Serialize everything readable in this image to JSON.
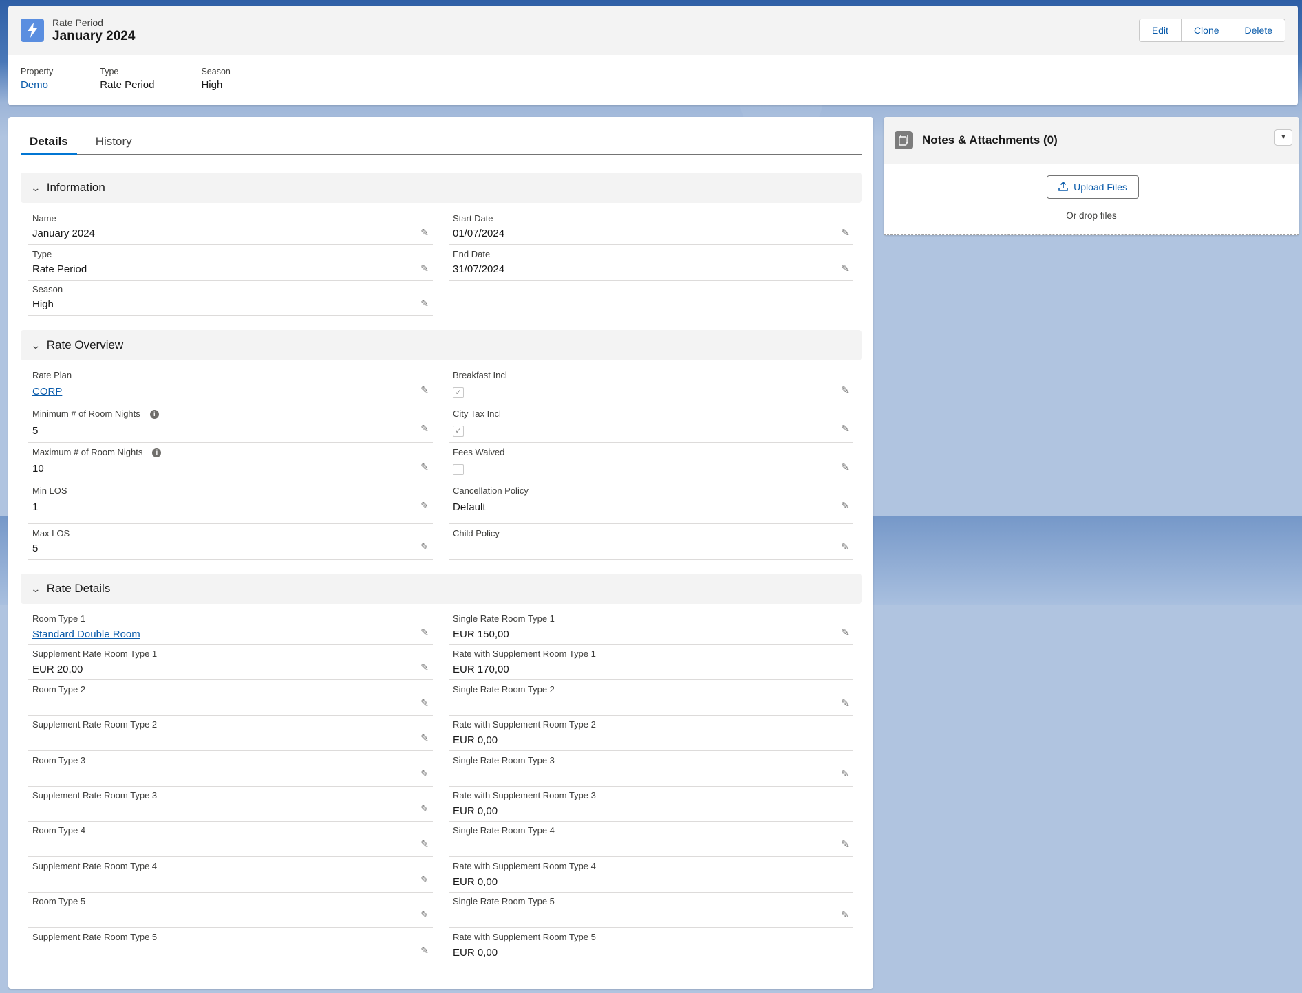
{
  "header": {
    "object_label": "Rate Period",
    "record_name": "January 2024",
    "actions": {
      "edit": "Edit",
      "clone": "Clone",
      "delete": "Delete"
    },
    "highlights": [
      {
        "label": "Property",
        "value": "Demo"
      },
      {
        "label": "Type",
        "value": "Rate Period"
      },
      {
        "label": "Season",
        "value": "High"
      }
    ]
  },
  "tabs": {
    "details": "Details",
    "history": "History"
  },
  "sections": {
    "information": {
      "title": "Information",
      "name_label": "Name",
      "name_value": "January 2024",
      "type_label": "Type",
      "type_value": "Rate Period",
      "season_label": "Season",
      "season_value": "High",
      "start_label": "Start Date",
      "start_value": "01/07/2024",
      "end_label": "End Date",
      "end_value": "31/07/2024"
    },
    "rate_overview": {
      "title": "Rate Overview",
      "rate_plan_label": "Rate Plan",
      "rate_plan_value": "CORP",
      "min_nights_label": "Minimum # of Room Nights",
      "min_nights_value": "5",
      "max_nights_label": "Maximum # of Room Nights",
      "max_nights_value": "10",
      "min_los_label": "Min LOS",
      "min_los_value": "1",
      "max_los_label": "Max LOS",
      "max_los_value": "5",
      "breakfast_label": "Breakfast Incl",
      "breakfast_checked": true,
      "city_tax_label": "City Tax Incl",
      "city_tax_checked": true,
      "fees_label": "Fees Waived",
      "fees_checked": false,
      "cancel_label": "Cancellation Policy",
      "cancel_value": "Default",
      "child_label": "Child Policy",
      "child_value": ""
    },
    "rate_details": {
      "title": "Rate Details",
      "left": [
        {
          "label": "Room Type 1",
          "value": "Standard Double Room",
          "link": true
        },
        {
          "label": "Supplement Rate Room Type 1",
          "value": "EUR 20,00"
        },
        {
          "label": "Room Type 2",
          "value": ""
        },
        {
          "label": "Supplement Rate Room Type 2",
          "value": ""
        },
        {
          "label": "Room Type 3",
          "value": ""
        },
        {
          "label": "Supplement Rate Room Type 3",
          "value": ""
        },
        {
          "label": "Room Type 4",
          "value": ""
        },
        {
          "label": "Supplement Rate Room Type 4",
          "value": ""
        },
        {
          "label": "Room Type 5",
          "value": ""
        },
        {
          "label": "Supplement Rate Room Type 5",
          "value": ""
        }
      ],
      "right": [
        {
          "label": "Single Rate Room Type 1",
          "value": "EUR 150,00",
          "editable": true
        },
        {
          "label": "Rate with Supplement Room Type 1",
          "value": "EUR 170,00",
          "editable": false
        },
        {
          "label": "Single Rate Room Type 2",
          "value": "",
          "editable": true
        },
        {
          "label": "Rate with Supplement Room Type 2",
          "value": "EUR 0,00",
          "editable": false
        },
        {
          "label": "Single Rate Room Type 3",
          "value": "",
          "editable": true
        },
        {
          "label": "Rate with Supplement Room Type 3",
          "value": "EUR 0,00",
          "editable": false
        },
        {
          "label": "Single Rate Room Type 4",
          "value": "",
          "editable": true
        },
        {
          "label": "Rate with Supplement Room Type 4",
          "value": "EUR 0,00",
          "editable": false
        },
        {
          "label": "Single Rate Room Type 5",
          "value": "",
          "editable": true
        },
        {
          "label": "Rate with Supplement Room Type 5",
          "value": "EUR 0,00",
          "editable": false
        }
      ]
    }
  },
  "notes": {
    "title": "Notes & Attachments (0)",
    "upload_label": "Upload Files",
    "drop_text": "Or drop files"
  },
  "icons": {
    "record": "bolt-icon",
    "edit": "pencil-icon",
    "notes": "file-icon",
    "upload": "upload-icon",
    "menu": "chevron-down-icon",
    "section": "chevron-down-icon",
    "info": "info-icon"
  },
  "colors": {
    "brand": "#0176d3",
    "link": "#0b5cab",
    "record_icon": "#5a8ee0"
  }
}
